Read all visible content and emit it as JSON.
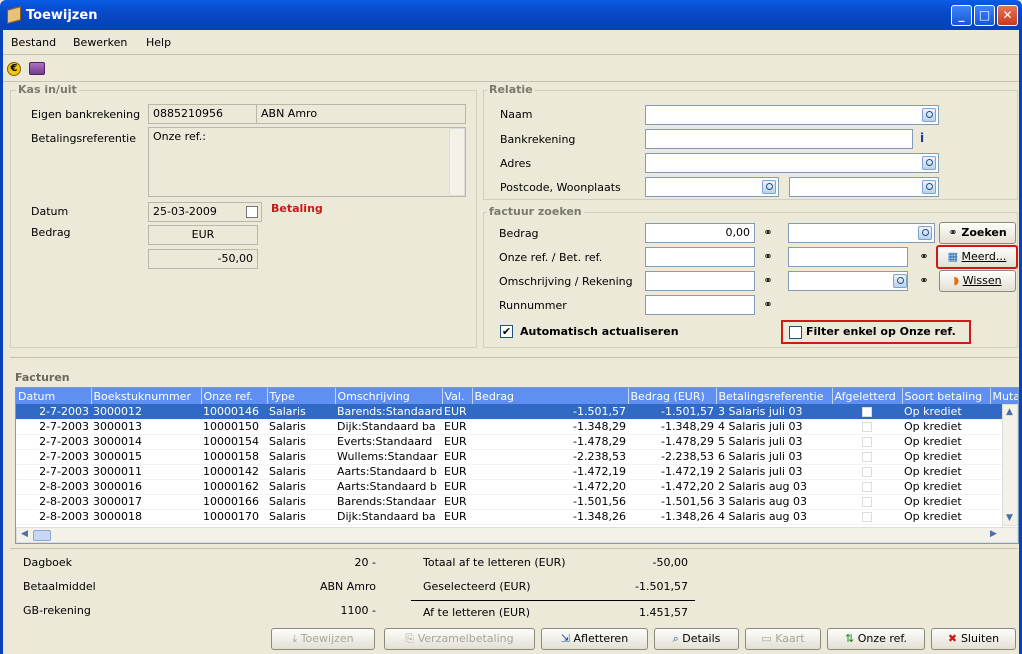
{
  "window": {
    "title": "Toewijzen"
  },
  "menu": [
    "Bestand",
    "Bewerken",
    "Help"
  ],
  "kas": {
    "title": "Kas in/uit",
    "eigen_label": "Eigen bankrekening",
    "eigen_account": "0885210956",
    "eigen_bank": "ABN Amro",
    "betref_label": "Betalingsreferentie",
    "betref_value": "Onze ref.:",
    "datum_label": "Datum",
    "datum_value": "25-03-2009",
    "betaling": "Betaling",
    "bedrag_label": "Bedrag",
    "currency": "EUR",
    "amount": "-50,00"
  },
  "relatie": {
    "title": "Relatie",
    "naam": "Naam",
    "bankrekening": "Bankrekening",
    "adres": "Adres",
    "postcode": "Postcode, Woonplaats"
  },
  "factuur": {
    "title": "factuur zoeken",
    "bedrag_label": "Bedrag",
    "bedrag_value": "0,00",
    "onzeref_label": "Onze ref. / Bet. ref.",
    "omschr_label": "Omschrijving / Rekening",
    "run_label": "Runnummer",
    "zoeken": "Zoeken",
    "meerd": "Meerd...",
    "wissen": "Wissen",
    "auto_label": "Automatisch actualiseren",
    "auto_checked": true,
    "filter_label": "Filter enkel op Onze ref.",
    "filter_checked": false
  },
  "facturen": {
    "title": "Facturen",
    "columns": [
      "Datum",
      "Boekstuknummer",
      "Onze ref.",
      "Type",
      "Omschrijving",
      "Val.",
      "Bedrag",
      "Bedrag (EUR)",
      "Betalingsreferentie",
      "Afgeletterd",
      "Soort betaling",
      "Mutat"
    ],
    "rows": [
      [
        "2-7-2003",
        "3000012",
        "10000146",
        "Salaris",
        "Barends:Standaard",
        "EUR",
        "-1.501,57",
        "-1.501,57",
        "3 Salaris juli 03",
        "",
        "Op krediet"
      ],
      [
        "2-7-2003",
        "3000013",
        "10000150",
        "Salaris",
        "Dijk:Standaard ba",
        "EUR",
        "-1.348,29",
        "-1.348,29",
        "4 Salaris juli 03",
        "",
        "Op krediet"
      ],
      [
        "2-7-2003",
        "3000014",
        "10000154",
        "Salaris",
        "Everts:Standaard",
        "EUR",
        "-1.478,29",
        "-1.478,29",
        "5 Salaris juli 03",
        "",
        "Op krediet"
      ],
      [
        "2-7-2003",
        "3000015",
        "10000158",
        "Salaris",
        "Wullems:Standaar",
        "EUR",
        "-2.238,53",
        "-2.238,53",
        "6 Salaris juli 03",
        "",
        "Op krediet"
      ],
      [
        "2-7-2003",
        "3000011",
        "10000142",
        "Salaris",
        "Aarts:Standaard b",
        "EUR",
        "-1.472,19",
        "-1.472,19",
        "2 Salaris juli 03",
        "",
        "Op krediet"
      ],
      [
        "2-8-2003",
        "3000016",
        "10000162",
        "Salaris",
        "Aarts:Standaard b",
        "EUR",
        "-1.472,20",
        "-1.472,20",
        "2 Salaris aug 03",
        "",
        "Op krediet"
      ],
      [
        "2-8-2003",
        "3000017",
        "10000166",
        "Salaris",
        "Barends:Standaar",
        "EUR",
        "-1.501,56",
        "-1.501,56",
        "3 Salaris aug 03",
        "",
        "Op krediet"
      ],
      [
        "2-8-2003",
        "3000018",
        "10000170",
        "Salaris",
        "Dijk:Standaard ba",
        "EUR",
        "-1.348,26",
        "-1.348,26",
        "4 Salaris aug 03",
        "",
        "Op krediet"
      ]
    ]
  },
  "summary": {
    "dagboek_label": "Dagboek",
    "dagboek_value": "20 -",
    "betaalmiddel_label": "Betaalmiddel",
    "betaalmiddel_value": "ABN Amro",
    "gb_label": "GB-rekening",
    "gb_value": "1100 -",
    "totaal_label": "Totaal af te letteren (EUR)",
    "totaal_value": "-50,00",
    "geselect_label": "Geselecteerd (EUR)",
    "geselect_value": "-1.501,57",
    "af_label": "Af te letteren (EUR)",
    "af_value": "1.451,57"
  },
  "buttons": {
    "toewijzen": "Toewijzen",
    "verzamel": "Verzamelbetaling",
    "afletteren": "Afletteren",
    "details": "Details",
    "kaart": "Kaart",
    "onzeref": "Onze ref.",
    "sluiten": "Sluiten"
  },
  "colors": {
    "title_bar": "#0a5ce6",
    "selection": "#316ac5",
    "header": "#5f8ff0",
    "accent_red": "#d01818"
  }
}
